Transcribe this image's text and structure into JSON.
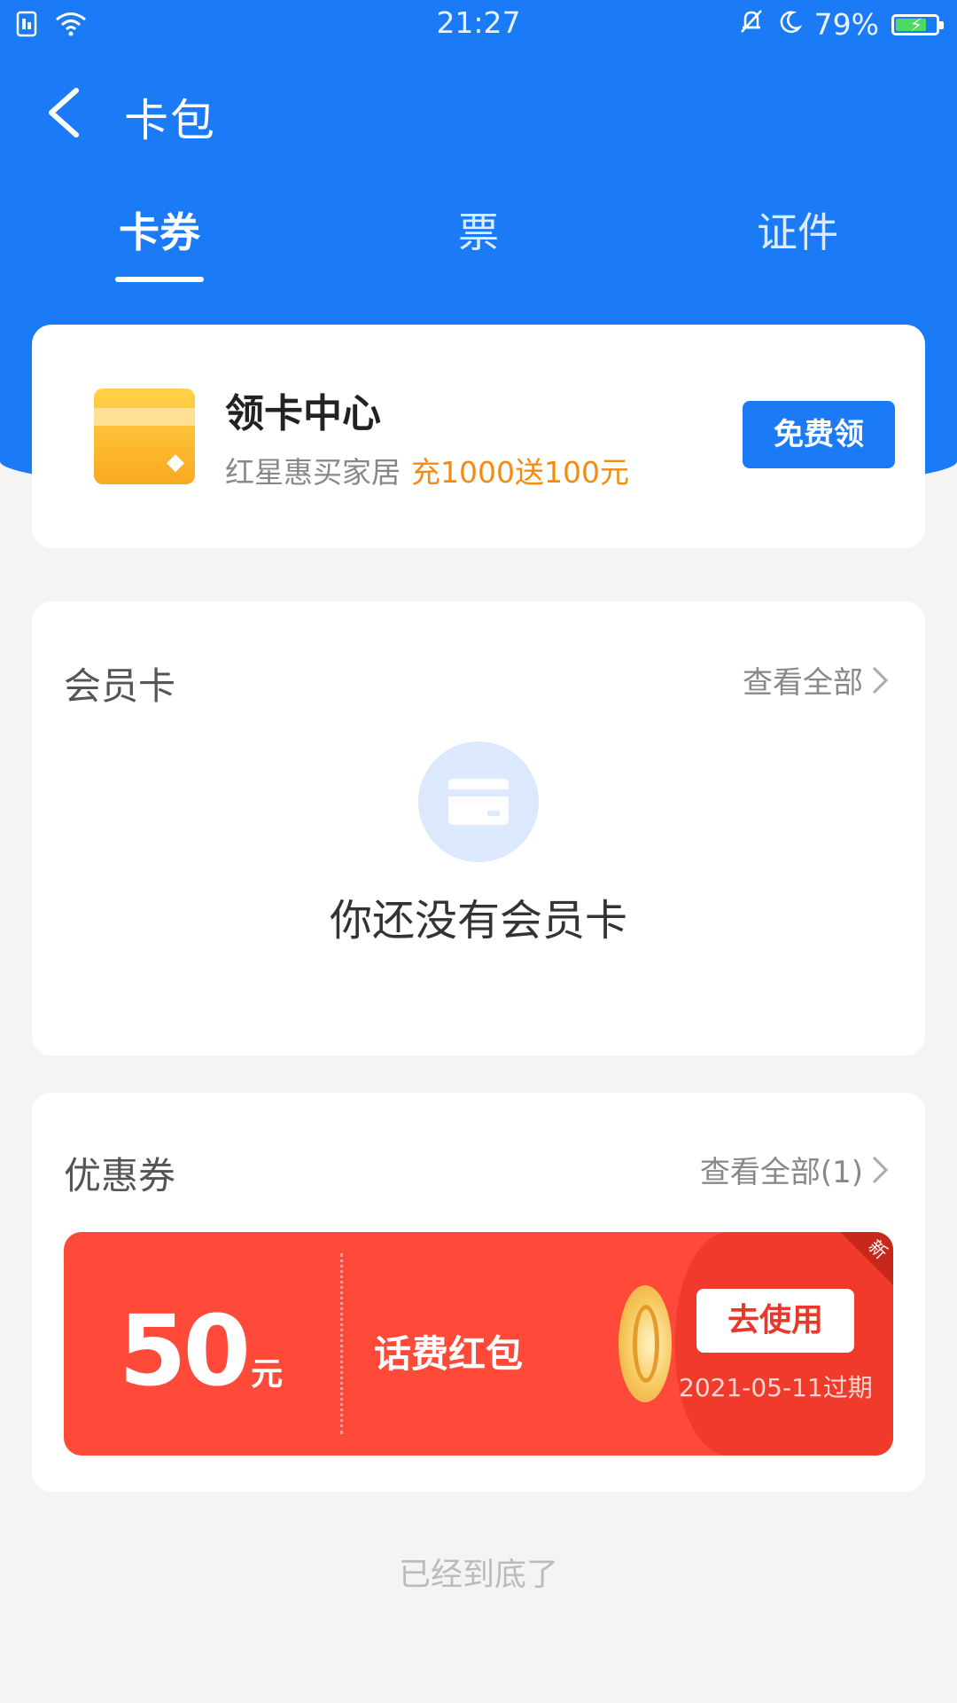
{
  "status_bar": {
    "time": "21:27",
    "battery": "79%",
    "icons": [
      "sim-icon",
      "wifi-icon",
      "bell-muted-icon",
      "moon-icon",
      "battery-icon"
    ],
    "battery_fill_color": "#4cd964"
  },
  "nav": {
    "title": "卡包"
  },
  "tabs": [
    {
      "label": "卡券",
      "active": true
    },
    {
      "label": "票",
      "active": false
    },
    {
      "label": "证件",
      "active": false
    }
  ],
  "promo": {
    "title": "领卡中心",
    "subtitle": "红星惠买家居",
    "highlight": "充1000送100元",
    "button": "免费领"
  },
  "member_section": {
    "title": "会员卡",
    "view_all": "查看全部",
    "empty_text": "你还没有会员卡"
  },
  "coupon_section": {
    "title": "优惠券",
    "view_all": "查看全部(1)",
    "coupon": {
      "amount": "50",
      "unit": "元",
      "name": "话费红包",
      "button": "去使用",
      "expire": "2021-05-11过期",
      "badge": "新"
    }
  },
  "footer": {
    "end_text": "已经到底了"
  },
  "colors": {
    "primary": "#1b7bf7",
    "accent_orange": "#f28c11",
    "coupon_red": "#ff4a3a"
  }
}
